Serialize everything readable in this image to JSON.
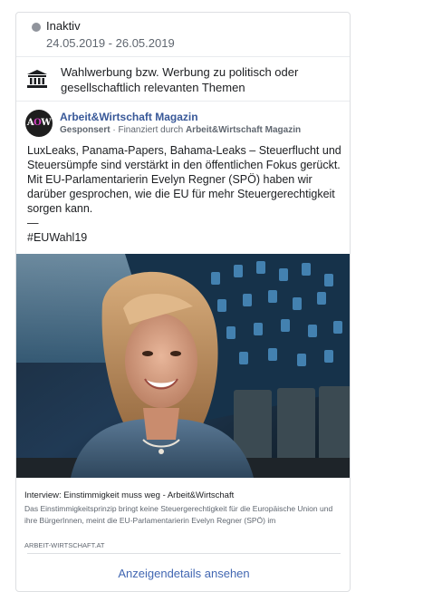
{
  "status": {
    "label": "Inaktiv",
    "dates": "24.05.2019 - 26.05.2019",
    "dot_color": "#90949c"
  },
  "category": {
    "icon": "government-building-icon",
    "text": "Wahlwerbung bzw. Werbung zu politisch oder gesellschaftlich relevanten Themen"
  },
  "advertiser": {
    "avatar_letter_a": "A",
    "avatar_letter_o": "O",
    "avatar_letter_w": "W",
    "name": "Arbeit&Wirtschaft Magazin",
    "sponsored_label": "Gesponsert",
    "funded_prefix": " · Finanziert durch ",
    "funded_by": "Arbeit&Wirtschaft Magazin"
  },
  "post": {
    "line1": "LuxLeaks, Panama-Papers, Bahama-Leaks – Steuerflucht und Steuersümpfe sind verstärkt in den öffentlichen Fokus gerückt. Mit EU-Parlamentarierin Evelyn Regner (SPÖ) haben wir darüber gesprochen, wie die EU für mehr Steuergerechtigkeit sorgen kann.",
    "dash": "—",
    "hashtag": "#EUWahl19"
  },
  "link": {
    "title": "Interview: Einstimmigkeit muss weg - Arbeit&Wirtschaft",
    "description": "Das Einstimmigkeitsprinzip bringt keine Steuergerechtigkeit für die Europäische Union und ihre BürgerInnen, meint die EU-Parlamentarierin Evelyn Regner (SPÖ) im",
    "domain": "ARBEIT-WIRTSCHAFT.AT"
  },
  "footer": {
    "details_label": "Anzeigendetails ansehen"
  },
  "colors": {
    "link_blue": "#4267b2",
    "name_blue": "#385898"
  }
}
